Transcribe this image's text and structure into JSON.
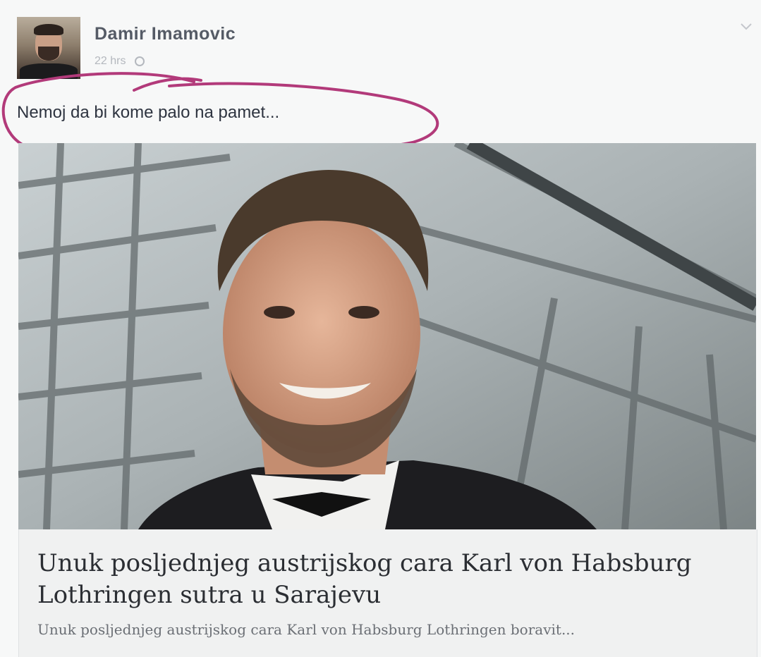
{
  "post": {
    "author_name": "Damir Imamovic",
    "timestamp": "22 hrs",
    "message": "Nemoj da bi kome palo na pamet...",
    "annotation_color": "#b23a7a"
  },
  "icons": {
    "privacy": "globe-icon",
    "options": "chevron-down-icon"
  },
  "link_card": {
    "headline": "Unuk posljednjeg austrijskog cara Karl von Habsburg Lothringen sutra u Sarajevu",
    "summary": "Unuk posljednjeg austrijskog cara Karl von Habsburg Lothringen boravit..."
  }
}
